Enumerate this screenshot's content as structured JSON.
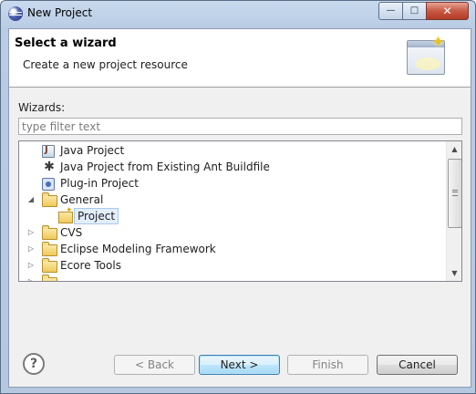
{
  "window": {
    "title": "New Project",
    "controls": {
      "minimize": "—",
      "maximize": "□",
      "close": "✕"
    }
  },
  "banner": {
    "title": "Select a wizard",
    "description": "Create a new project resource"
  },
  "wizards": {
    "label": "Wizards:",
    "filter_placeholder": "type filter text",
    "filter_value": ""
  },
  "tree": {
    "items": [
      {
        "label": "Java Project",
        "icon": "java-project-icon",
        "level": 1,
        "expanded": null,
        "selected": false
      },
      {
        "label": "Java Project from Existing Ant Buildfile",
        "icon": "ant-icon",
        "level": 1,
        "expanded": null,
        "selected": false
      },
      {
        "label": "Plug-in Project",
        "icon": "plugin-project-icon",
        "level": 1,
        "expanded": null,
        "selected": false
      },
      {
        "label": "General",
        "icon": "folder-icon",
        "level": 0,
        "expanded": true,
        "selected": false
      },
      {
        "label": "Project",
        "icon": "project-icon",
        "level": 1,
        "expanded": null,
        "selected": true
      },
      {
        "label": "CVS",
        "icon": "folder-icon",
        "level": 0,
        "expanded": false,
        "selected": false
      },
      {
        "label": "Eclipse Modeling Framework",
        "icon": "folder-icon",
        "level": 0,
        "expanded": false,
        "selected": false
      },
      {
        "label": "Ecore Tools",
        "icon": "folder-icon",
        "level": 0,
        "expanded": false,
        "selected": false
      }
    ],
    "twisty_expanded": "◢",
    "twisty_collapsed": "▷",
    "scroll_up": "▲",
    "scroll_down": "▼"
  },
  "buttons": {
    "help": "?",
    "back": "< Back",
    "next": "Next >",
    "finish": "Finish",
    "cancel": "Cancel"
  }
}
